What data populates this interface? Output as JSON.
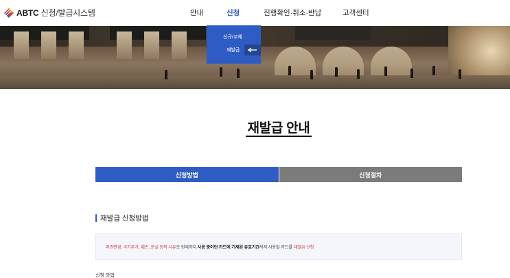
{
  "header": {
    "logo_brand": "ABTC",
    "logo_sub": " 신청/발급시스템"
  },
  "nav": {
    "items": [
      {
        "label": "안내",
        "active": false
      },
      {
        "label": "신청",
        "active": true
      },
      {
        "label": "진행확인·취소·반납",
        "active": false
      },
      {
        "label": "고객센터",
        "active": false
      }
    ]
  },
  "dropdown": {
    "items": [
      "신규/교체",
      "재발급"
    ],
    "selected": "재발급"
  },
  "page": {
    "title": "재발급 안내"
  },
  "tabs": [
    {
      "label": "신청방법",
      "active": true
    },
    {
      "label": "신청절차",
      "active": false
    }
  ],
  "section": {
    "heading": "재발급 신청방법",
    "notice": {
      "part1": "여권변경, 국가추가, 훼손, 분실 등의 사유",
      "part2": "로 현재까지 ",
      "part3": "사용 중이던 카드에 기재된 유효기간",
      "part4": "까지 사용할 카드를 ",
      "part5": "재발급 신청"
    },
    "sub_label": "신청 방법"
  },
  "colors": {
    "accent": "#2f5cc4",
    "tab_inactive": "#7b7b7b",
    "notice_red": "#d23a3a"
  }
}
